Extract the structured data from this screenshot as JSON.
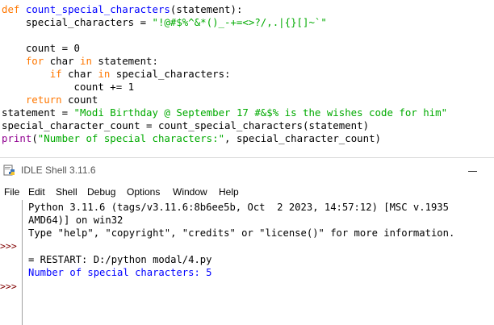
{
  "editor": {
    "lines": [
      {
        "segments": [
          [
            "kw",
            "def"
          ],
          [
            "p",
            " "
          ],
          [
            "fn",
            "count_special_characters"
          ],
          [
            "p",
            "(statement):"
          ]
        ]
      },
      {
        "segments": [
          [
            "p",
            "    special_characters = "
          ],
          [
            "str",
            "\"!@#$%^&*()_-+=<>?/,.|{}[]~`\""
          ]
        ]
      },
      {
        "segments": [
          [
            "p",
            ""
          ]
        ]
      },
      {
        "segments": [
          [
            "p",
            "    count = 0"
          ]
        ]
      },
      {
        "segments": [
          [
            "p",
            "    "
          ],
          [
            "kw",
            "for"
          ],
          [
            "p",
            " char "
          ],
          [
            "kw",
            "in"
          ],
          [
            "p",
            " statement:"
          ]
        ]
      },
      {
        "segments": [
          [
            "p",
            "        "
          ],
          [
            "kw",
            "if"
          ],
          [
            "p",
            " char "
          ],
          [
            "kw",
            "in"
          ],
          [
            "p",
            " special_characters:"
          ]
        ]
      },
      {
        "segments": [
          [
            "p",
            "            count += 1"
          ]
        ]
      },
      {
        "segments": [
          [
            "p",
            "    "
          ],
          [
            "kw",
            "return"
          ],
          [
            "p",
            " count"
          ]
        ]
      },
      {
        "segments": [
          [
            "p",
            "statement = "
          ],
          [
            "str",
            "\"Modi Birthday @ September 17 #&$% is the wishes code for him\""
          ]
        ]
      },
      {
        "segments": [
          [
            "p",
            "special_character_count = count_special_characters(statement)"
          ]
        ]
      },
      {
        "segments": [
          [
            "bi",
            "print"
          ],
          [
            "p",
            "("
          ],
          [
            "str",
            "\"Number of special characters:\""
          ],
          [
            "p",
            ", special_character_count)"
          ]
        ]
      }
    ]
  },
  "shell": {
    "title": "IDLE Shell 3.11.6",
    "icon": "idle-python-icon",
    "menu": [
      "File",
      "Edit",
      "Shell",
      "Debug",
      "Options",
      "Window",
      "Help"
    ],
    "lines": {
      "banner1": "Python 3.11.6 (tags/v3.11.6:8b6ee5b, Oct  2 2023, 14:57:12) [MSC v.1935",
      "banner2": "AMD64)] on win32",
      "banner3": "Type \"help\", \"copyright\", \"credits\" or \"license()\" for more information.",
      "restart": "= RESTART: D:/python modal/4.py",
      "output": "Number of special characters: 5"
    },
    "prompt": ">>>"
  },
  "colors": {
    "keyword": "#ff7700",
    "function": "#0000ff",
    "string": "#00aa00",
    "builtin": "#900090",
    "output": "#0000ff",
    "prompt": "#800000"
  }
}
